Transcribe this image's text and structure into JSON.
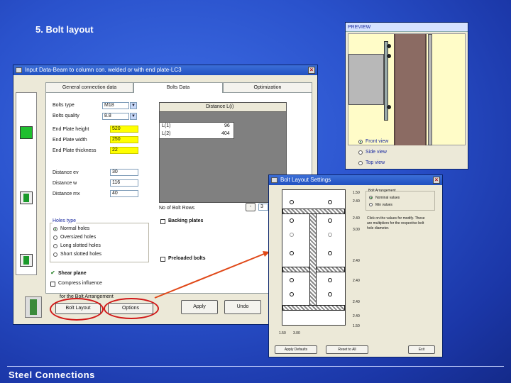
{
  "slide": {
    "title": "5. Bolt layout",
    "footer": "Steel Connections"
  },
  "preview": {
    "title": "PREVIEW",
    "views": [
      "Front view",
      "Side view",
      "Top view"
    ],
    "selected_view": "Front view"
  },
  "main_dialog": {
    "title": "Input Data-Beam to column con. welded or with end plate-LC3",
    "tabs": [
      "General connection data",
      "Bolts Data",
      "Optimization"
    ],
    "active_tab": "Bolts Data",
    "fields": {
      "bolts_type_label": "Bolts type",
      "bolts_type_value": "M18",
      "bolts_quality_label": "Bolts quality",
      "bolts_quality_value": "8.8",
      "end_plate_height_label": "End Plate height",
      "end_plate_height_value": "520",
      "end_plate_width_label": "End Plate width",
      "end_plate_width_value": "250",
      "end_plate_thickness_label": "End Plate thickness",
      "end_plate_thickness_value": "22",
      "distance_ev_label": "Distance ev",
      "distance_ev_value": "30",
      "distance_w_label": "Distance w",
      "distance_w_value": "116",
      "distance_mx_label": "Distance mx",
      "distance_mx_value": "40"
    },
    "distance_table": {
      "header": "Distance L(i)",
      "rows": [
        {
          "label": "L(1)",
          "value": "96"
        },
        {
          "label": "L(2)",
          "value": "404"
        }
      ]
    },
    "no_of_bolt_rows_label": "No of Bolt Rows",
    "no_of_bolt_rows_value": "3",
    "holes_type": {
      "title": "Holes type",
      "options": [
        "Normal holes",
        "Oversized holes",
        "Long slotted holes",
        "Short slotted holes"
      ],
      "selected": "Normal holes"
    },
    "backing_plates_label": "Backing plates",
    "preloaded_bolts_label": "Preloaded bolts",
    "shear_plane_label": "Shear plane",
    "compress_influence_label": "Compress influence",
    "bolt_arrangement_label": "for the Bolt Arrangement",
    "buttons": {
      "bolt_layout": "Bolt Layout",
      "options": "Options",
      "apply": "Apply",
      "undo": "Undo"
    }
  },
  "bolt_layout_dialog": {
    "title": "Bolt Layout Settings",
    "note": "Click on the values for modify. These are multipliers for the respective bolt hole diameter.",
    "legend_title": "Bolt Arrangement",
    "radio_options": [
      "Nominal values",
      "Min values"
    ],
    "selected_option": "Nominal values",
    "right_dims": [
      "1.50",
      "2.40",
      "2.40",
      "3.00",
      "2.40",
      "2.40",
      "2.40",
      "2.40",
      "1.50"
    ],
    "bottom_dims": [
      "1.50",
      "3.00"
    ],
    "buttons": {
      "apply_defaults": "Apply Defaults",
      "reset_all": "Reset to All",
      "exit": "Exit"
    }
  }
}
